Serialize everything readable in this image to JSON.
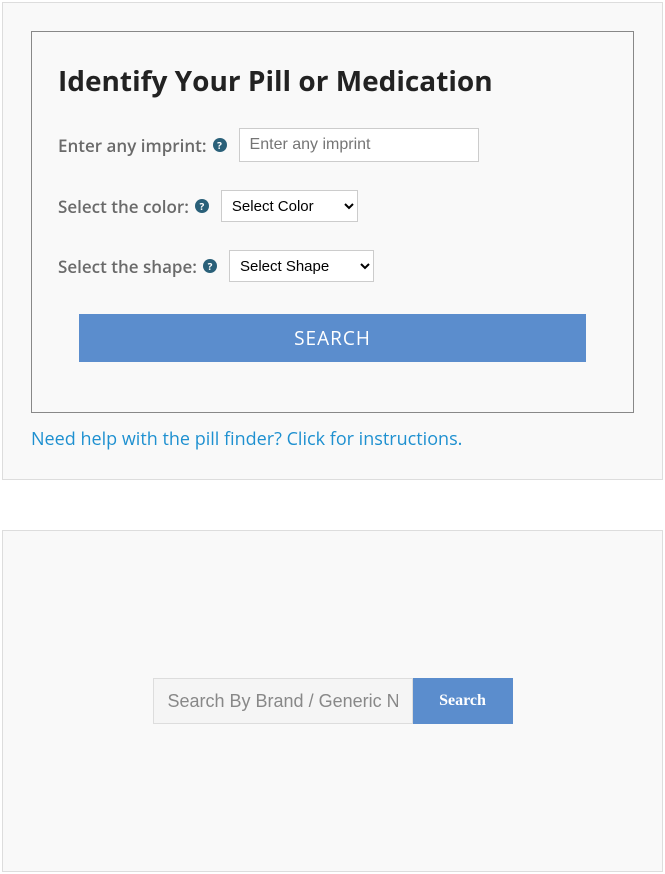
{
  "pill_finder": {
    "title": "Identify Your Pill or Medication",
    "imprint": {
      "label": "Enter any imprint:",
      "placeholder": "Enter any imprint"
    },
    "color": {
      "label": "Select the color:",
      "selected": "Select Color"
    },
    "shape": {
      "label": "Select the shape:",
      "selected": "Select Shape"
    },
    "search_label": "SEARCH",
    "help_link": "Need help with the pill finder? Click for instructions.",
    "help_icon_char": "?"
  },
  "brand_search": {
    "placeholder": "Search By Brand / Generic Name",
    "button_label": "Search"
  }
}
